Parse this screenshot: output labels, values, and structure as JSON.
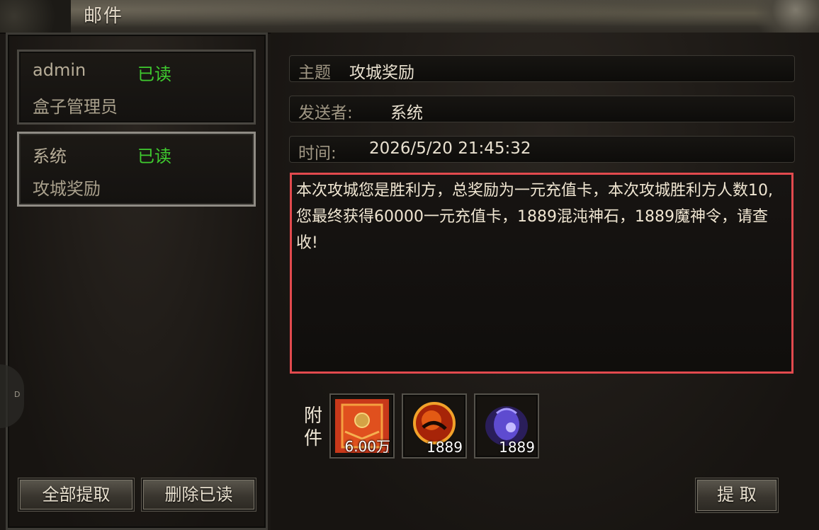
{
  "window": {
    "title": "邮件"
  },
  "side_handle": {
    "label": "D"
  },
  "mail_list": [
    {
      "sender": "admin",
      "status": "已读",
      "subject": "盒子管理员"
    },
    {
      "sender": "系统",
      "status": "已读",
      "subject": "攻城奖励"
    }
  ],
  "left_buttons": {
    "collect_all": "全部提取",
    "delete_read": "删除已读"
  },
  "detail": {
    "subject_label": "主题",
    "subject_value": "攻城奖励",
    "sender_label": "发送者:",
    "sender_value": "系统",
    "time_label": "时间:",
    "time_value": "2026/5/20 21:45:32",
    "body": "本次攻城您是胜利方，总奖励为一元充值卡，本次攻城胜利方人数10,您最终获得60000一元充值卡，1889混沌神石，1889魔神令，请查收!"
  },
  "attachments": {
    "label": "附件",
    "items": [
      {
        "icon": "recharge-card-icon",
        "qty": "6.00万"
      },
      {
        "icon": "chaos-stone-icon",
        "qty": "1889"
      },
      {
        "icon": "demon-token-icon",
        "qty": "1889"
      }
    ]
  },
  "collect_button": "提  取",
  "colors": {
    "read_status": "#3fcb2f",
    "highlight_border": "#e24a4e"
  }
}
